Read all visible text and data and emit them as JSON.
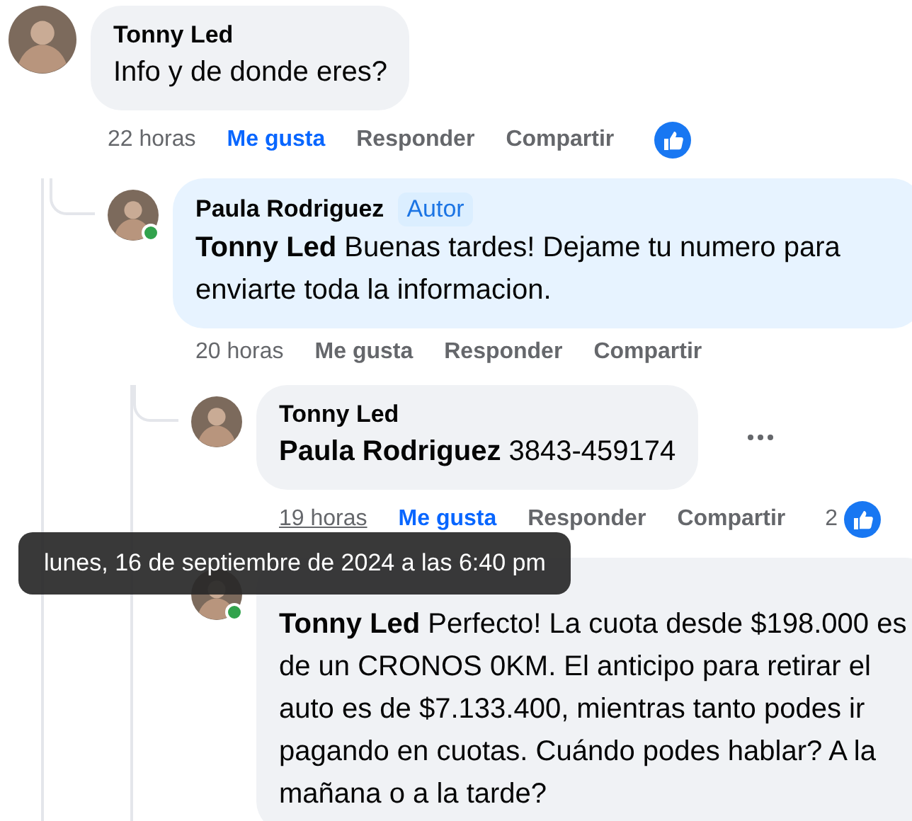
{
  "comments": [
    {
      "author": "Tonny Led",
      "text": "Info y de donde eres?",
      "time": "22 horas",
      "time_underlined": false,
      "liked": true,
      "actions": [
        "Me gusta",
        "Responder",
        "Compartir"
      ],
      "has_reactions": true,
      "children": [
        {
          "author": "Paula Rodriguez",
          "badge": "Autor",
          "text": "**Tonny Led** Buenas tardes! Dejame tu numero para enviarte toda la informacion.",
          "online": true,
          "time": "20 horas",
          "time_underlined": false,
          "liked": false,
          "actions": [
            "Me gusta",
            "Responder",
            "Compartir"
          ],
          "children": [
            {
              "author": "Tonny Led",
              "text": "**Paula Rodriguez** 3843-459174",
              "menu_visible": true,
              "time": "19 horas",
              "time_underlined": true,
              "liked": true,
              "actions": [
                "Me gusta",
                "Responder",
                "Compartir"
              ],
              "has_reactions": true,
              "reaction_count": "2"
            },
            {
              "text": "**Tonny Led** Perfecto! La cuota desde $198.000 es de un CRONOS 0KM. El anticipo para retirar el auto es de $7.133.400, mientras tanto podes ir pagando en cuotas. Cuándo podes hablar? A la mañana o a la tarde?",
              "online": true
            }
          ]
        }
      ]
    }
  ],
  "tooltip": {
    "text": "lunes, 16 de septiembre de 2024 a las 6:40 pm"
  }
}
